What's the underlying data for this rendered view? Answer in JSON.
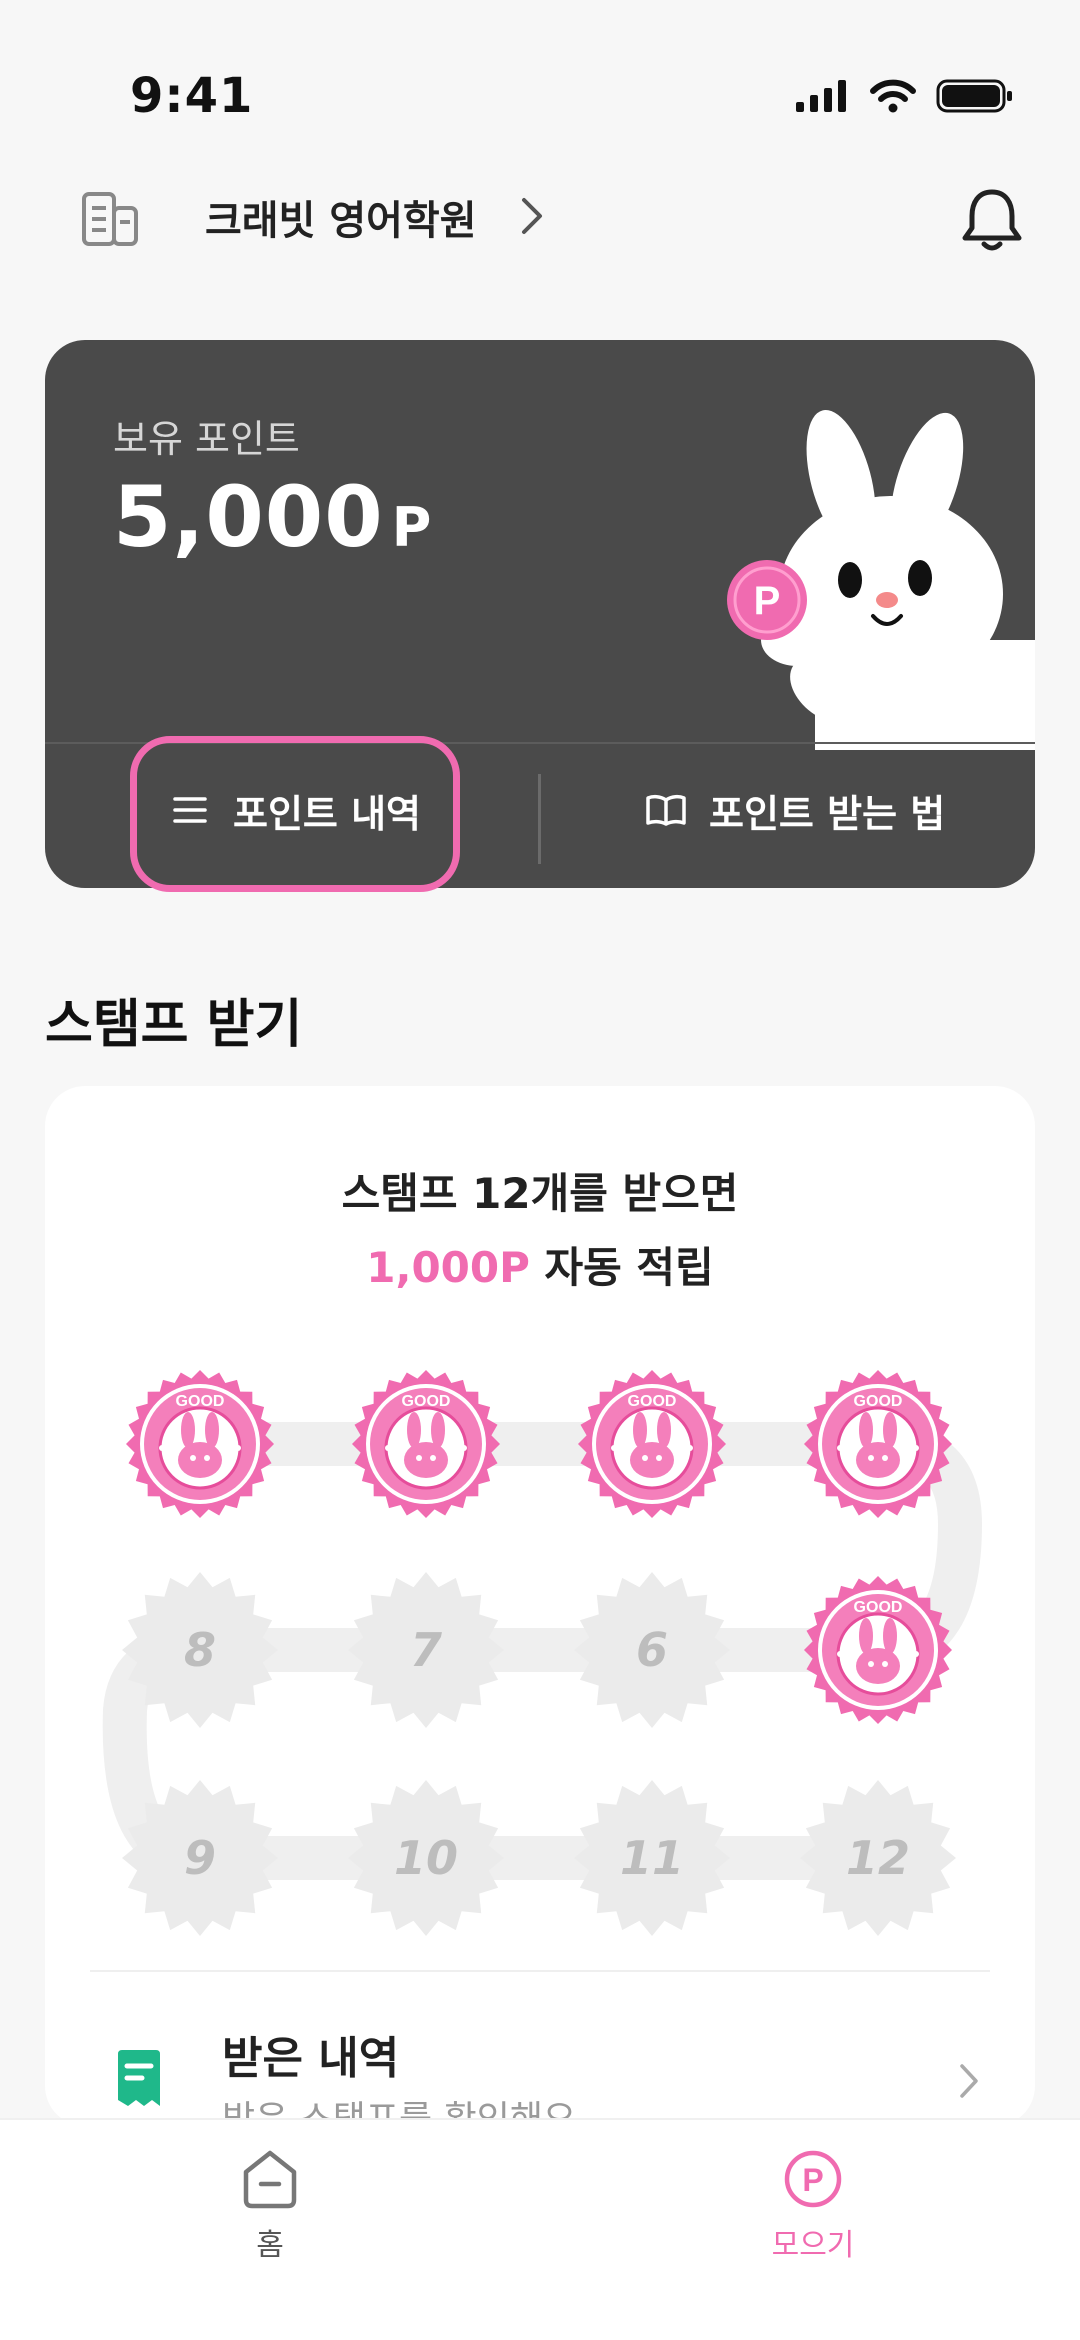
{
  "status_bar": {
    "time": "9:41"
  },
  "header": {
    "academy_name": "크래빗 영어학원"
  },
  "points_card": {
    "label": "보유 포인트",
    "value": "5,000",
    "unit": "P",
    "coin_letter": "P",
    "history_button": "포인트 내역",
    "howto_button": "포인트 받는 법"
  },
  "stamp_section": {
    "title": "스탬프 받기",
    "desc_line1": "스탬프 12개를 받으면",
    "desc_highlight": "1,000P",
    "desc_line2_rest": " 자동 적립",
    "stamp_text": "GOOD",
    "stamps_collected": 5,
    "stamps_total": 12,
    "empty_stamps": [
      "8",
      "7",
      "6",
      "9",
      "10",
      "11",
      "12"
    ]
  },
  "received": {
    "title": "받은 내역",
    "subtitle": "받은 스탬프를 확인해요"
  },
  "bottom_nav": {
    "home_label": "홈",
    "collect_label": "모으기",
    "collect_icon_letter": "P"
  },
  "colors": {
    "accent": "#f06bb0",
    "card_bg": "#4a4a4a",
    "received_icon": "#1fb88a"
  }
}
